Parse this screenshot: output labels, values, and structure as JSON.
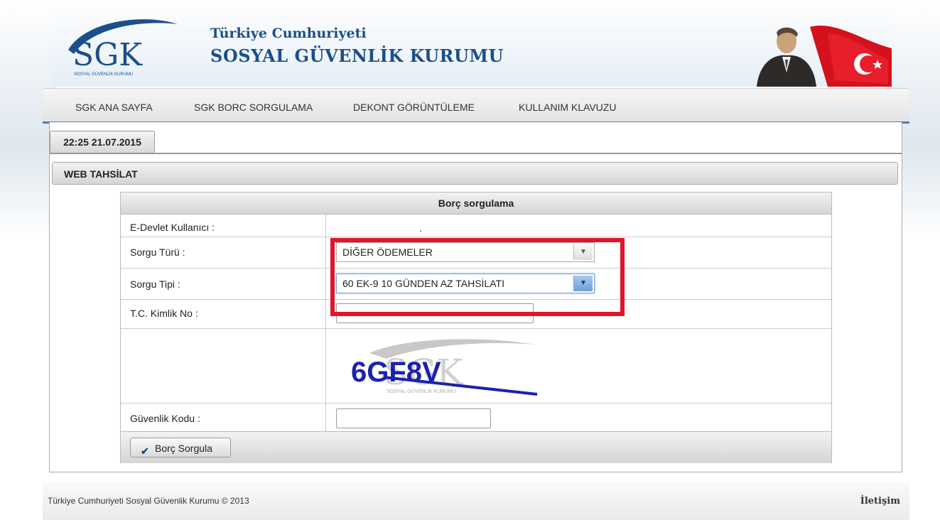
{
  "header": {
    "org_line1": "Türkiye Cumhuriyeti",
    "org_line2": "SOSYAL GÜVENLİK KURUMU",
    "logo_text": "SGK",
    "logo_subtext": "SOSYAL GÜVENLİK KURUMU"
  },
  "nav": {
    "items": [
      {
        "label": "SGK ANA SAYFA"
      },
      {
        "label": "SGK BORC SORGULAMA"
      },
      {
        "label": "DEKONT GÖRÜNTÜLEME"
      },
      {
        "label": "KULLANIM KLAVUZU"
      }
    ]
  },
  "clock": "22:25 21.07.2015",
  "panel_title": "WEB TAHSİLAT",
  "form": {
    "title": "Borç sorgulama",
    "edevlet_label": "E-Devlet Kullanıcı :",
    "edevlet_value": ".",
    "sorgu_turu_label": "Sorgu Türü :",
    "sorgu_turu_value": "DİĞER ÖDEMELER",
    "sorgu_tipi_label": "Sorgu Tipi :",
    "sorgu_tipi_value": "60 EK-9 10 GÜNDEN AZ TAHSİLATI",
    "tc_label": "T.C. Kimlik No :",
    "tc_value": "",
    "captcha_text": "6GF8V",
    "guvenlik_label": "Güvenlik Kodu :",
    "guvenlik_value": "",
    "submit_label": "Borç Sorgula"
  },
  "footer": {
    "copyright": "Türkiye Cumhuriyeti Sosyal Güvenlik Kurumu © 2013",
    "contact": "İletişim"
  },
  "colors": {
    "brand_blue": "#1b4f8a",
    "nav_accent": "#4f7fb0",
    "highlight_red": "#e0142a",
    "captcha_blue": "#1a22b0"
  }
}
